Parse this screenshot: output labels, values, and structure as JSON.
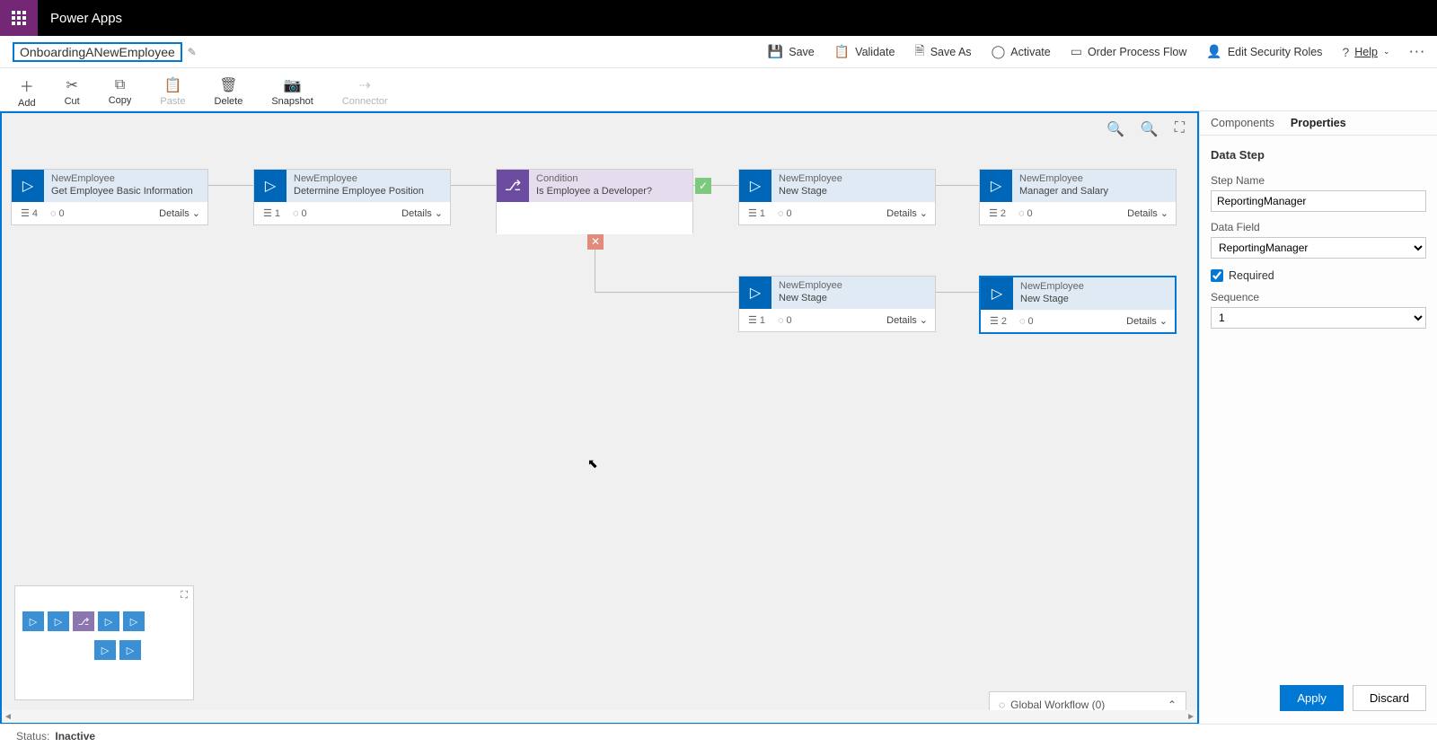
{
  "app_name": "Power Apps",
  "flow_name": "OnboardingANewEmployee",
  "header_commands": {
    "save": "Save",
    "validate": "Validate",
    "save_as": "Save As",
    "activate": "Activate",
    "order": "Order Process Flow",
    "security": "Edit Security Roles",
    "help": "Help"
  },
  "toolbar": {
    "add": "Add",
    "cut": "Cut",
    "copy": "Copy",
    "paste": "Paste",
    "delete": "Delete",
    "snapshot": "Snapshot",
    "connector": "Connector"
  },
  "stages": {
    "s1": {
      "entity": "NewEmployee",
      "title": "Get Employee Basic Information",
      "steps": "4",
      "triggers": "0",
      "details": "Details"
    },
    "s2": {
      "entity": "NewEmployee",
      "title": "Determine Employee Position",
      "steps": "1",
      "triggers": "0",
      "details": "Details"
    },
    "cond": {
      "entity": "Condition",
      "title": "Is Employee a Developer?"
    },
    "s3": {
      "entity": "NewEmployee",
      "title": "New Stage",
      "steps": "1",
      "triggers": "0",
      "details": "Details"
    },
    "s4": {
      "entity": "NewEmployee",
      "title": "Manager and Salary",
      "steps": "2",
      "triggers": "0",
      "details": "Details"
    },
    "s5": {
      "entity": "NewEmployee",
      "title": "New Stage",
      "steps": "1",
      "triggers": "0",
      "details": "Details"
    },
    "s6": {
      "entity": "NewEmployee",
      "title": "New Stage",
      "steps": "2",
      "triggers": "0",
      "details": "Details"
    }
  },
  "global_workflow": "Global Workflow (0)",
  "rpanel": {
    "tab_components": "Components",
    "tab_properties": "Properties",
    "section": "Data Step",
    "step_name_label": "Step Name",
    "step_name_value": "ReportingManager",
    "data_field_label": "Data Field",
    "data_field_value": "ReportingManager",
    "required_label": "Required",
    "sequence_label": "Sequence",
    "sequence_value": "1",
    "apply": "Apply",
    "discard": "Discard"
  },
  "status": {
    "label": "Status:",
    "value": "Inactive"
  }
}
